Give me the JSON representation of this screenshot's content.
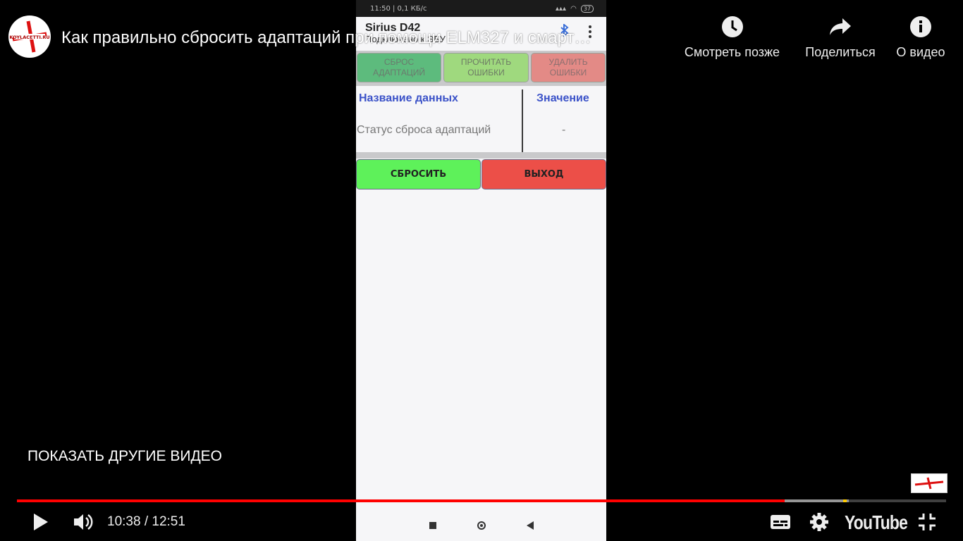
{
  "player": {
    "video_title": "Как правильно сбросить адаптаций при помощи ELM327 и смарт…",
    "channel_logo_text": "KOYLACETTI.RU",
    "top_actions": {
      "watch_later": "Смотреть позже",
      "share": "Поделиться",
      "about": "О видео"
    },
    "more_videos": "ПОКАЗАТЬ ДРУГИЕ ВИДЕО",
    "time": "10:38 / 12:51",
    "progress_fraction": 0.826,
    "buffer_fraction": 0.895,
    "brand": "YouTube",
    "colors": {
      "progress": "#ff0000",
      "marker": "#ffcc00"
    }
  },
  "phone": {
    "status_bar": {
      "clock": "11:50 | 0,1 КБ/с",
      "battery": "37"
    },
    "app": {
      "title": "Sirius D42",
      "subtitle": "Подключено к ЭБУ"
    },
    "tabs": [
      "СБРОС АДАПТАЦИЙ",
      "ПРОЧИТАТЬ ОШИБКИ",
      "УДАЛИТЬ ОШИБКИ"
    ],
    "table": {
      "headers": {
        "name": "Название данных",
        "value": "Значение"
      },
      "rows": [
        {
          "name": "Статус сброса адаптаций",
          "value": "-"
        }
      ]
    },
    "buttons": {
      "reset": "СБРОСИТЬ",
      "exit": "ВЫХОД"
    }
  }
}
